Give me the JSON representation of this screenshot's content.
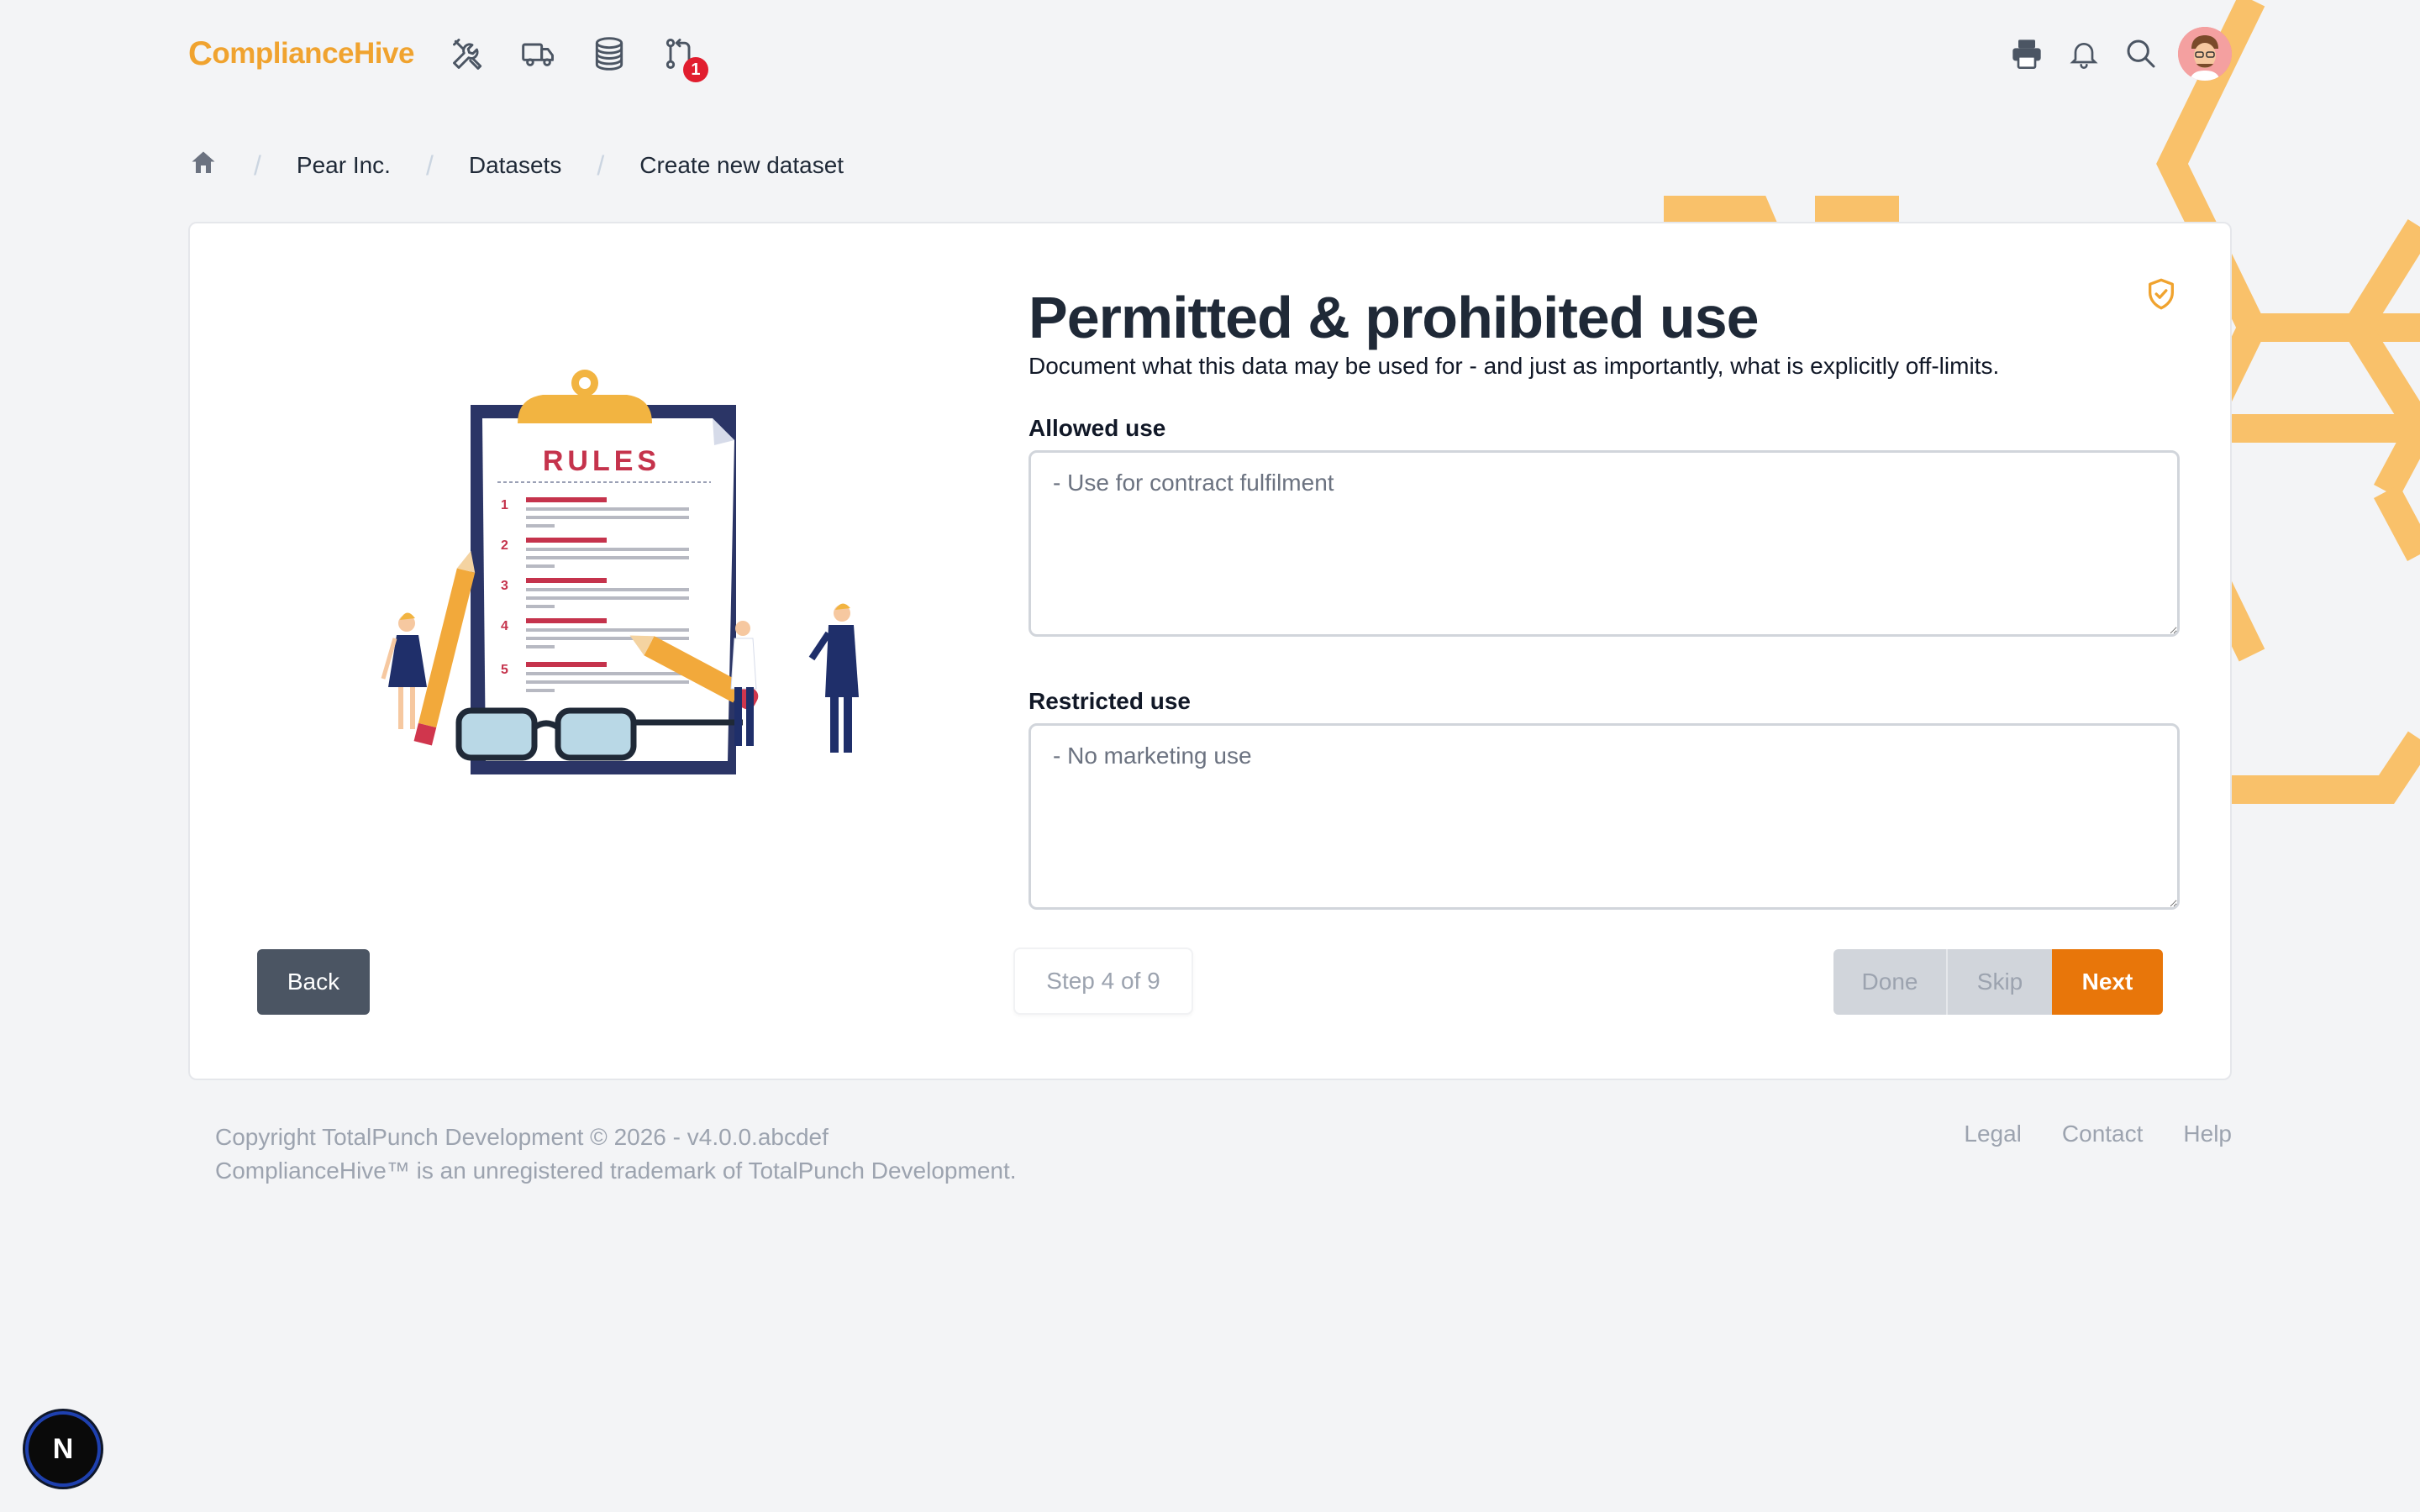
{
  "app": {
    "logo_text": "omplianceHive",
    "logo_initial": "C"
  },
  "nav": {
    "badge_count": "1",
    "icons": [
      "tools-icon",
      "truck-icon",
      "database-icon",
      "pull-request-icon"
    ],
    "right_icons": [
      "printer-icon",
      "bell-icon",
      "search-icon",
      "avatar"
    ]
  },
  "breadcrumb": {
    "items": [
      "Pear Inc.",
      "Datasets",
      "Create new dataset"
    ],
    "separator": "/"
  },
  "form": {
    "title": "Permitted & prohibited use",
    "subtitle": "Document what this data may be used for - and just as importantly, what is explicitly off-limits.",
    "allowed_label": "Allowed use",
    "allowed_placeholder": "- Use for contract fulfilment",
    "restricted_label": "Restricted use",
    "restricted_placeholder": "- No marketing use"
  },
  "illustration": {
    "heading": "RULES",
    "numbers": [
      "1",
      "2",
      "3",
      "4",
      "5"
    ]
  },
  "actions": {
    "back_label": "Back",
    "step_text": "Step 4 of 9",
    "done_label": "Done",
    "skip_label": "Skip",
    "next_label": "Next"
  },
  "footer": {
    "copyright": "Copyright TotalPunch Development © 2026 - v4.0.0.abcdef",
    "trademark": "ComplianceHive™ is an unregistered trademark of TotalPunch Development.",
    "links": [
      "Legal",
      "Contact",
      "Help"
    ]
  },
  "dev_badge": {
    "label": "N"
  },
  "colors": {
    "accent": "#e8760a",
    "brand": "#f0a32f",
    "honeycomb": "#f9c16a"
  }
}
